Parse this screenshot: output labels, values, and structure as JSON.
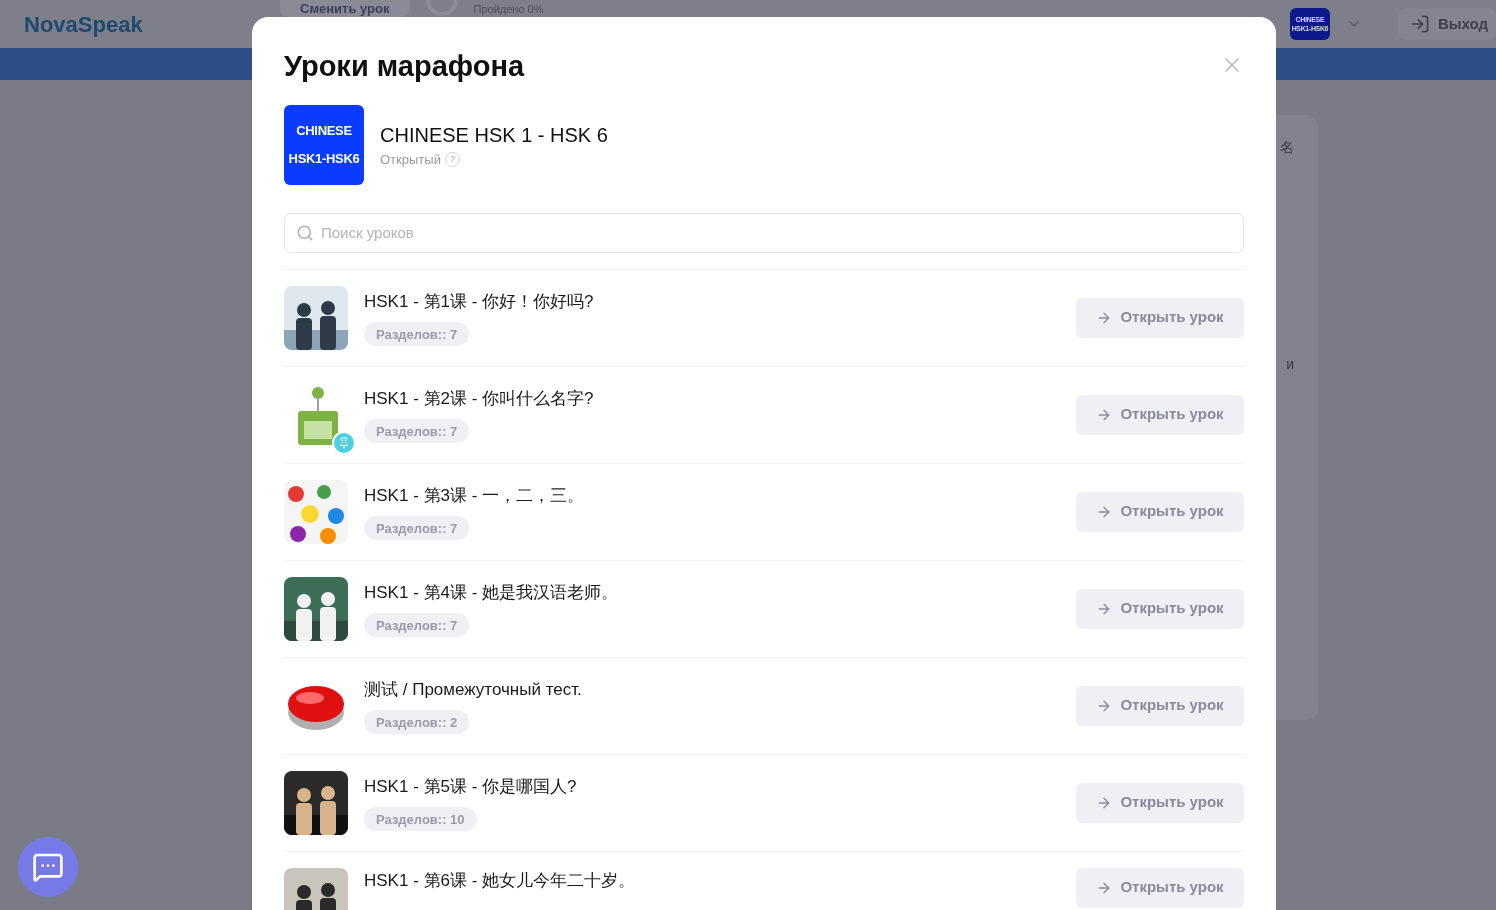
{
  "header": {
    "logo": "NovaSpeak",
    "change_button": "Сменить урок",
    "progress": "Пройдено 0%",
    "course_badge": [
      "CHINESE",
      "HSK1-HSK6"
    ],
    "logout": "Выход"
  },
  "background_card": {
    "texts": [
      "名",
      "и"
    ]
  },
  "modal": {
    "title": "Уроки марафона",
    "course": {
      "badge": [
        "CHINESE",
        "HSK1-HSK6"
      ],
      "name": "CHINESE HSK 1 - HSK 6",
      "access": "Открытый",
      "help": "?"
    },
    "search": {
      "placeholder": "Поиск уроков"
    },
    "lessons": [
      {
        "title": "HSK1 - 第1课 - 你好！你好吗?",
        "sections": "Разделов:: 7",
        "pinned": false,
        "button": "Открыть урок"
      },
      {
        "title": "HSK1 - 第2课 - 你叫什么名字?",
        "sections": "Разделов:: 7",
        "pinned": true,
        "button": "Открыть урок"
      },
      {
        "title": "HSK1 - 第3课 - 一，二，三。",
        "sections": "Разделов:: 7",
        "pinned": false,
        "button": "Открыть урок"
      },
      {
        "title": "HSK1 - 第4课 - 她是我汉语老师。",
        "sections": "Разделов:: 7",
        "pinned": false,
        "button": "Открыть урок"
      },
      {
        "title": "测试 / Промежуточный тест.",
        "sections": "Разделов:: 2",
        "pinned": false,
        "button": "Открыть урок"
      },
      {
        "title": "HSK1 - 第5课 - 你是哪国人?",
        "sections": "Разделов:: 10",
        "pinned": false,
        "button": "Открыть урок"
      },
      {
        "title": "HSK1 - 第6课 - 她女儿今年二十岁。",
        "pinned": false,
        "button": "Открыть урок"
      }
    ]
  }
}
